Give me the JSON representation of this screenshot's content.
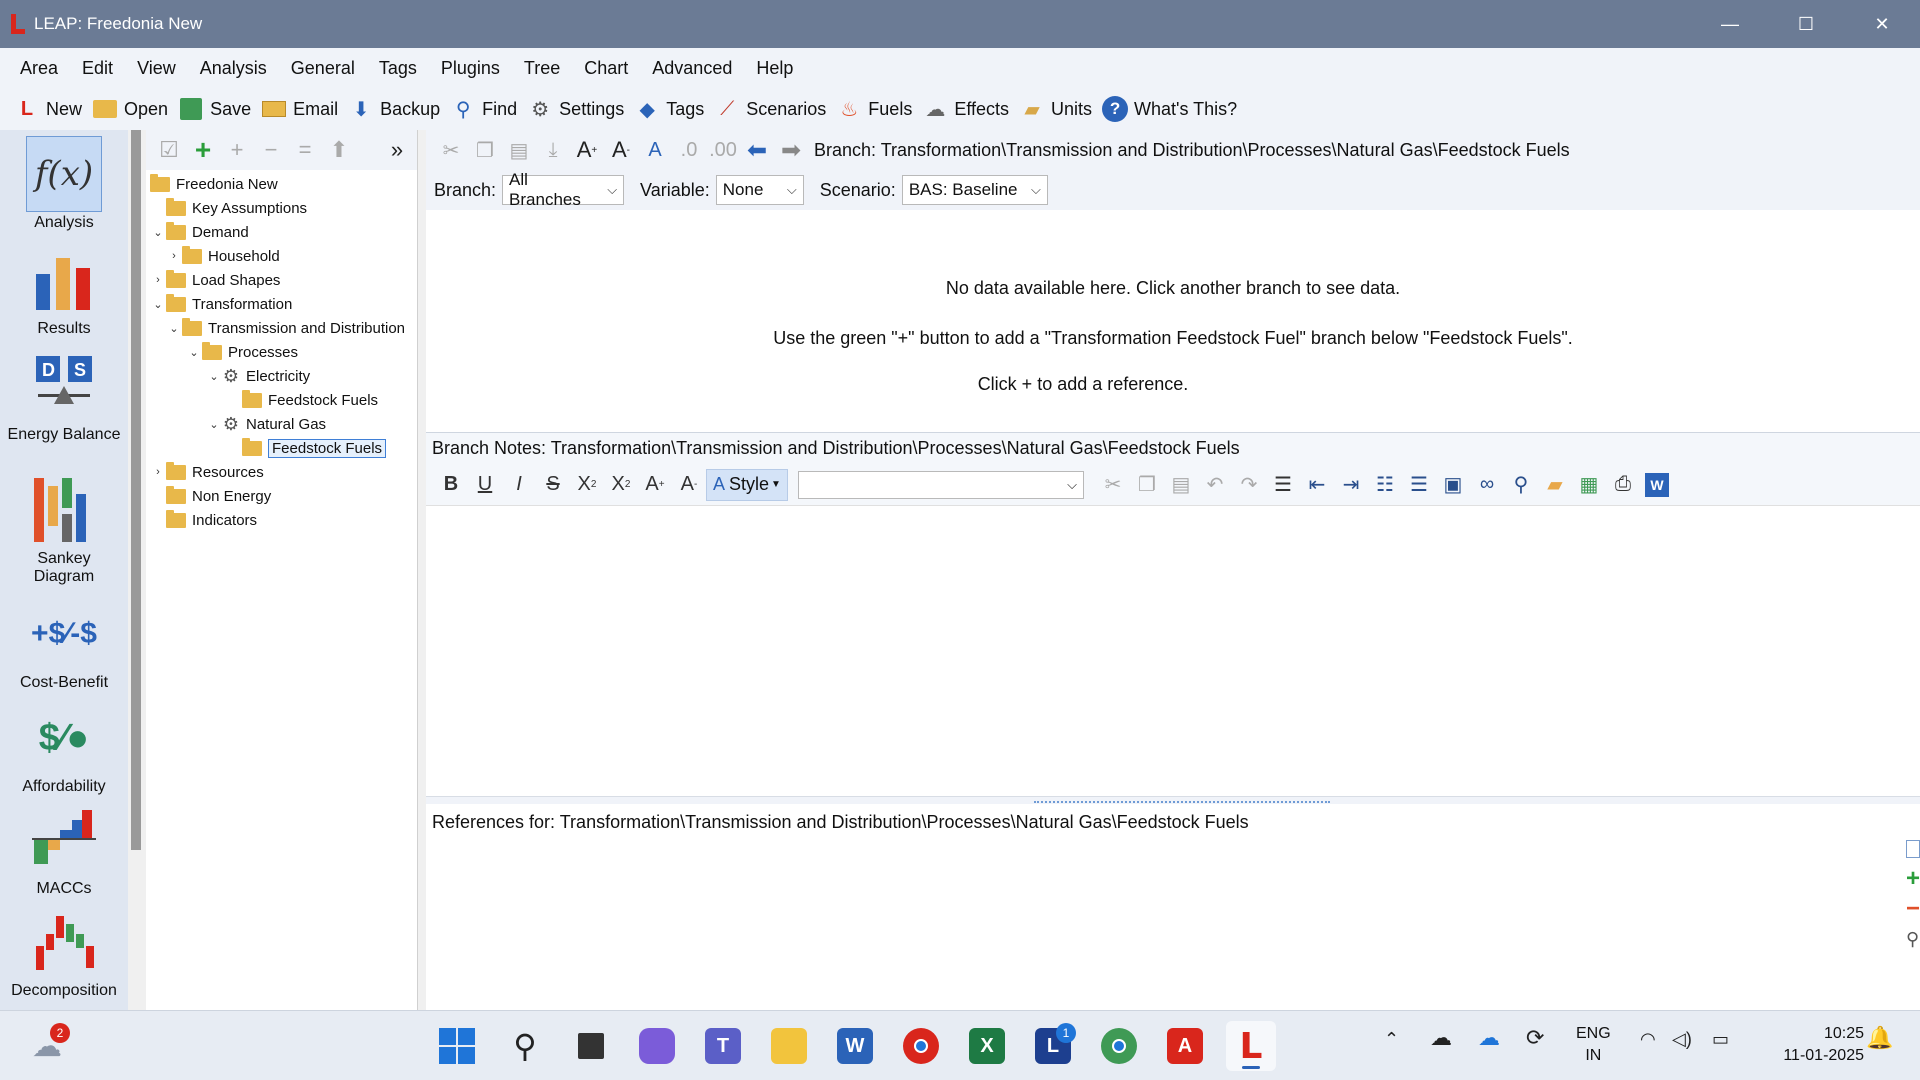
{
  "window": {
    "title": "LEAP: Freedonia New",
    "controls": [
      "—",
      "☐",
      "✕"
    ]
  },
  "menu": [
    "Area",
    "Edit",
    "View",
    "Analysis",
    "General",
    "Tags",
    "Plugins",
    "Tree",
    "Chart",
    "Advanced",
    "Help"
  ],
  "toolbar": {
    "new": "New",
    "open": "Open",
    "save": "Save",
    "email": "Email",
    "backup": "Backup",
    "find": "Find",
    "settings": "Settings",
    "tags": "Tags",
    "scenarios": "Scenarios",
    "fuels": "Fuels",
    "effects": "Effects",
    "units": "Units",
    "whats_this": "What's This?"
  },
  "views": {
    "analysis": "Analysis",
    "results": "Results",
    "energy_balance": "Energy Balance",
    "sankey": "Sankey Diagram",
    "cost_benefit": "Cost-Benefit",
    "affordability": "Affordability",
    "maccs": "MACCs",
    "decomposition": "Decomposition"
  },
  "tree": {
    "root": "Freedonia New",
    "key_assumptions": "Key Assumptions",
    "demand": "Demand",
    "household": "Household",
    "load_shapes": "Load Shapes",
    "transformation": "Transformation",
    "tnd": "Transmission and Distribution",
    "processes": "Processes",
    "electricity": "Electricity",
    "feedstock_fuels_1": "Feedstock Fuels",
    "natural_gas": "Natural Gas",
    "feedstock_fuels_2": "Feedstock Fuels",
    "resources": "Resources",
    "non_energy": "Non Energy",
    "indicators": "Indicators"
  },
  "main": {
    "branch_path": "Branch: Transformation\\Transmission and Distribution\\Processes\\Natural Gas\\Feedstock Fuels",
    "branch_label": "Branch:",
    "branch_value": "All Branches",
    "variable_label": "Variable:",
    "variable_value": "None",
    "scenario_label": "Scenario:",
    "scenario_value": "BAS: Baseline",
    "no_data": "No data available here. Click another branch to see data.",
    "hint": "Use the green \"+\" button to add a \"Transformation Feedstock Fuel\" branch below \"Feedstock Fuels\".",
    "notes_header": "Branch Notes: Transformation\\Transmission and Distribution\\Processes\\Natural Gas\\Feedstock Fuels",
    "style_label": "Style",
    "refs_header": "References for: Transformation\\Transmission and Distribution\\Processes\\Natural Gas\\Feedstock Fuels",
    "refs_message": "Click + to add a reference."
  },
  "taskbar": {
    "weather_badge": "2",
    "leap_badge": "1",
    "lang_top": "ENG",
    "lang_bottom": "IN",
    "time": "10:25",
    "date": "11-01-2025"
  }
}
